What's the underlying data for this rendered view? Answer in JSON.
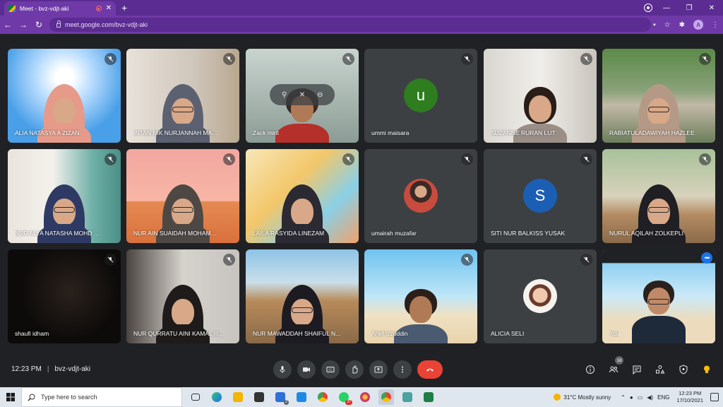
{
  "browser": {
    "tab_title": "Meet - bvz-vdjt-aki",
    "url": "meet.google.com/bvz-vdjt-aki",
    "profile_initial": "A"
  },
  "participants": [
    {
      "name": "ALIA NATASYA A ZIZAN",
      "muted": true
    },
    {
      "name": "INTAN NIK NURJANNAH MA...",
      "muted": true
    },
    {
      "name": "Zack mint",
      "muted": true
    },
    {
      "name": "ummi maisara",
      "muted": true,
      "initial": "u",
      "avatar_color": "#2e7d1f"
    },
    {
      "name": "SUZANNE RURAN LUT",
      "muted": true
    },
    {
      "name": "RABIATULADAWIYAH HAZLEE",
      "muted": true
    },
    {
      "name": "NUR ALYA NATASHA MOHD ...",
      "muted": true
    },
    {
      "name": "NUR AIN SUAIDAH MOHAM...",
      "muted": true
    },
    {
      "name": "LAILA RASYIDA LINEZAM",
      "muted": true
    },
    {
      "name": "umairah muzafar",
      "muted": true
    },
    {
      "name": "SITI NUR BALKISS YUSAK",
      "muted": true,
      "initial": "S",
      "avatar_color": "#1a5fb4"
    },
    {
      "name": "NURUL AQILAH ZOLKEPLI",
      "muted": true
    },
    {
      "name": "shaufi idham",
      "muted": true
    },
    {
      "name": "NUR QURRATU AINI KAMAL R...",
      "muted": true
    },
    {
      "name": "NUR MAWADDAH SHAIFUL N...",
      "muted": false
    },
    {
      "name": "Arief Izzuddin",
      "muted": true
    },
    {
      "name": "ALICIA SELI",
      "muted": true
    },
    {
      "name": "You",
      "muted": false
    }
  ],
  "meeting": {
    "time": "12:23 PM",
    "separator": "|",
    "code": "bvz-vdjt-aki",
    "participant_count": "18"
  },
  "taskbar": {
    "search_placeholder": "Type here to search",
    "badges": {
      "todo": "2",
      "whatsapp": "37"
    },
    "weather": "31°C  Mostly sunny",
    "language": "ENG",
    "clock_time": "12:23 PM",
    "clock_date": "17/10/2021"
  },
  "colors": {
    "chrome_frame": "#5b2c91",
    "meet_bg": "#202124",
    "hangup": "#ea4335",
    "you_highlight": "#8ab4f8"
  }
}
